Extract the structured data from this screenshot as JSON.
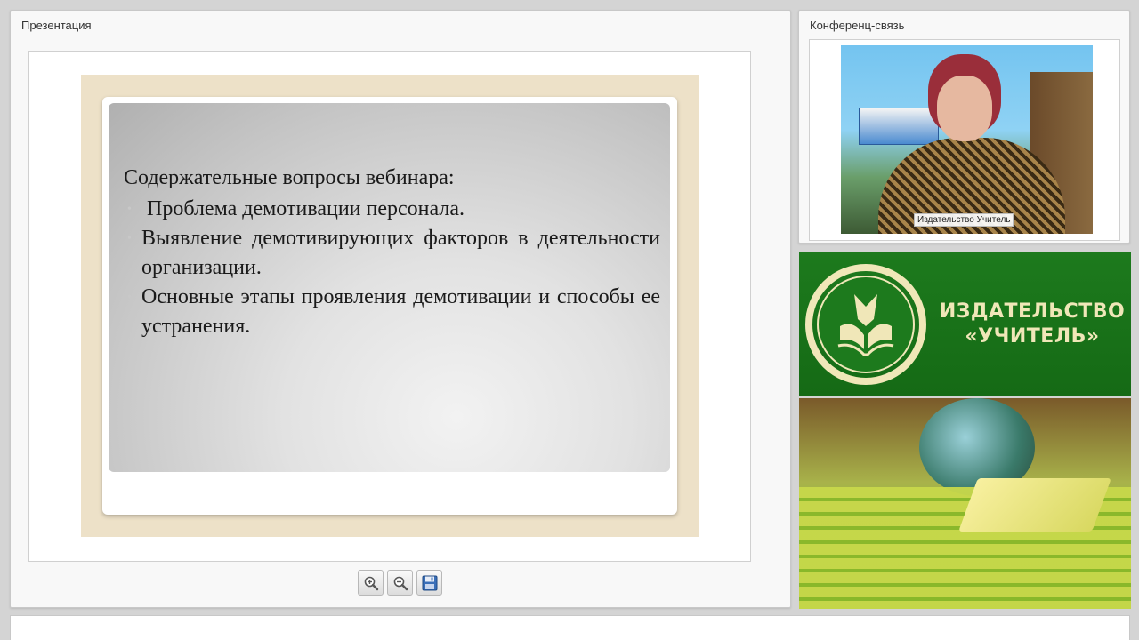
{
  "presentation": {
    "title": "Презентация",
    "slide": {
      "heading": "Содержательные вопросы вебинара:",
      "bullets": [
        "Проблема демотивации персонала.",
        "Выявление демотивирующих факторов в деятельности организации.",
        "Основные этапы проявления демотивации и способы ее устранения."
      ]
    },
    "toolbar": {
      "zoom_in_icon": "zoom-in-icon",
      "zoom_out_icon": "zoom-out-icon",
      "save_icon": "save-icon"
    }
  },
  "conference": {
    "title": "Конференц-связь",
    "video_caption": "Издательство Учитель"
  },
  "brand": {
    "line1": "ИЗДАТЕЛЬСТВО",
    "line2": "«УЧИТЕЛЬ»",
    "primary_color": "#1d7a1d",
    "text_color": "#f0e7b8"
  }
}
